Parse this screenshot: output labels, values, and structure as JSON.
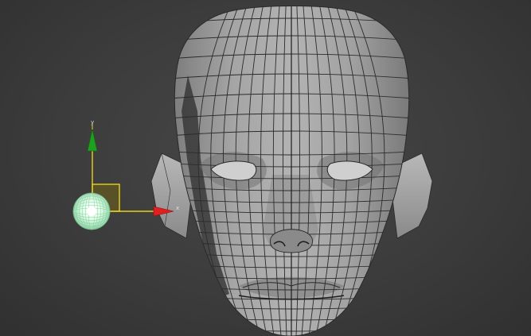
{
  "viewport": {
    "background": "#3c3c3c",
    "mesh_fill": "#9a9a9a",
    "mesh_wire": "#2a2a2a"
  },
  "gizmo": {
    "x_label": "x",
    "y_label": "y",
    "x_color": "#e02020",
    "y_color": "#1fa01f",
    "plane_color": "#e8d21c",
    "light_color": "#dfffe8"
  }
}
